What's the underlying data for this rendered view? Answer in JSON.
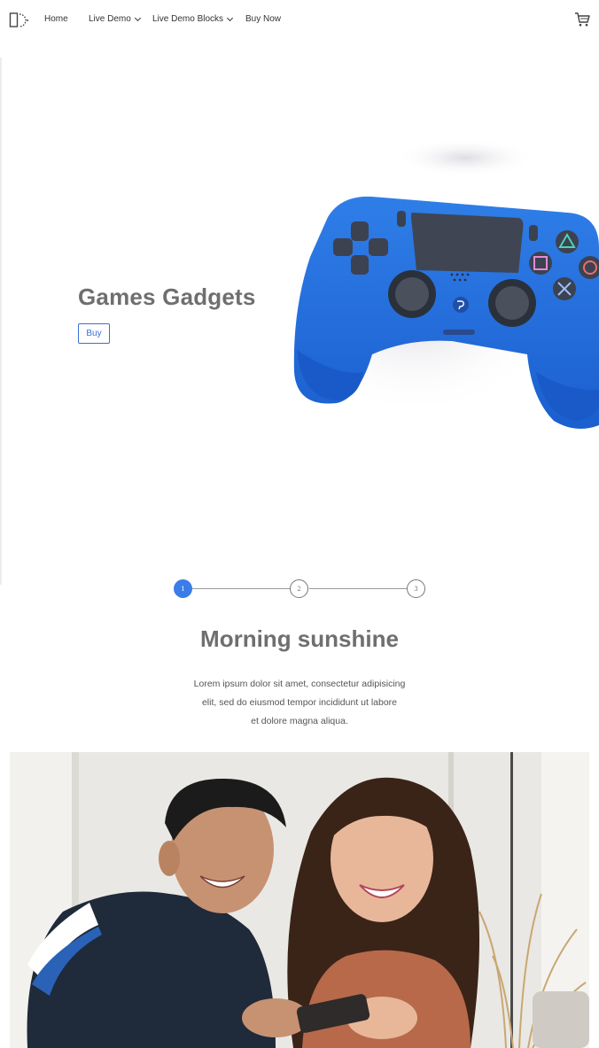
{
  "nav": {
    "items": [
      {
        "label": "Home",
        "dropdown": false
      },
      {
        "label": "Live Demo",
        "dropdown": true
      },
      {
        "label": "Live Demo Blocks",
        "dropdown": true
      },
      {
        "label": "Buy Now",
        "dropdown": false
      }
    ],
    "icons": {
      "logo": "brand-logo-icon",
      "cart": "cart-icon"
    }
  },
  "hero": {
    "title": "Games Gadgets",
    "button_label": "Buy",
    "accent_color": "#3a6fd8",
    "image": "blue-game-controller"
  },
  "stepper": {
    "steps": [
      "1",
      "2",
      "3"
    ],
    "active_step": 1,
    "active_color": "#3a7de8"
  },
  "feature": {
    "title": "Morning sunshine",
    "text_lines": [
      "Lorem ipsum dolor sit amet, consectetur adipisicing",
      "elit, sed do eiusmod tempor incididunt ut labore",
      "et dolore magna aliqua."
    ],
    "image": "couple-playing-handheld-game"
  }
}
